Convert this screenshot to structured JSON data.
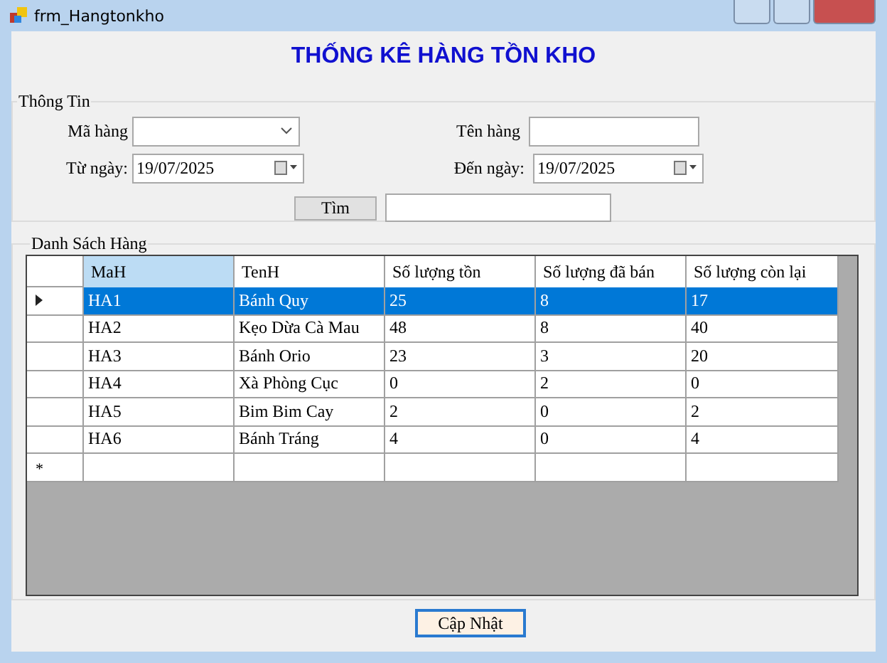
{
  "window": {
    "title": "frm_Hangtonkho"
  },
  "heading": "THỐNG KÊ HÀNG TỒN KHO",
  "info_group": {
    "title": "Thông Tin",
    "ma_hang": {
      "label": "Mã hàng"
    },
    "ten_hang": {
      "label": "Tên hàng"
    },
    "tu_ngay": {
      "label": "Từ ngày:",
      "value": "19/07/2025"
    },
    "den_ngay": {
      "label": "Đến ngày:",
      "value": "19/07/2025"
    },
    "search_button": "Tìm"
  },
  "list_group": {
    "title": "Danh Sách Hàng",
    "columns": [
      {
        "label": "MaH",
        "selected": true
      },
      {
        "label": "TenH",
        "selected": false
      },
      {
        "label": "Số lượng tồn",
        "selected": false
      },
      {
        "label": "Số lượng đã bán",
        "selected": false
      },
      {
        "label": "Số lượng còn lại",
        "selected": false
      }
    ],
    "rows": [
      {
        "cells": [
          "HA1",
          "Bánh Quy",
          "25",
          "8",
          "17"
        ],
        "selected": true
      },
      {
        "cells": [
          "HA2",
          "Kẹo Dừa Cà Mau",
          "48",
          "8",
          "40"
        ],
        "selected": false
      },
      {
        "cells": [
          "HA3",
          "Bánh Orio",
          "23",
          "3",
          "20"
        ],
        "selected": false
      },
      {
        "cells": [
          "HA4",
          "Xà Phòng Cục",
          "0",
          "2",
          "0"
        ],
        "selected": false
      },
      {
        "cells": [
          "HA5",
          "Bim Bim Cay",
          "2",
          "0",
          "2"
        ],
        "selected": false
      },
      {
        "cells": [
          "HA6",
          "Bánh Tráng",
          "4",
          "0",
          "4"
        ],
        "selected": false
      }
    ],
    "new_row_marker": "*"
  },
  "update_button": "Cập Nhật"
}
